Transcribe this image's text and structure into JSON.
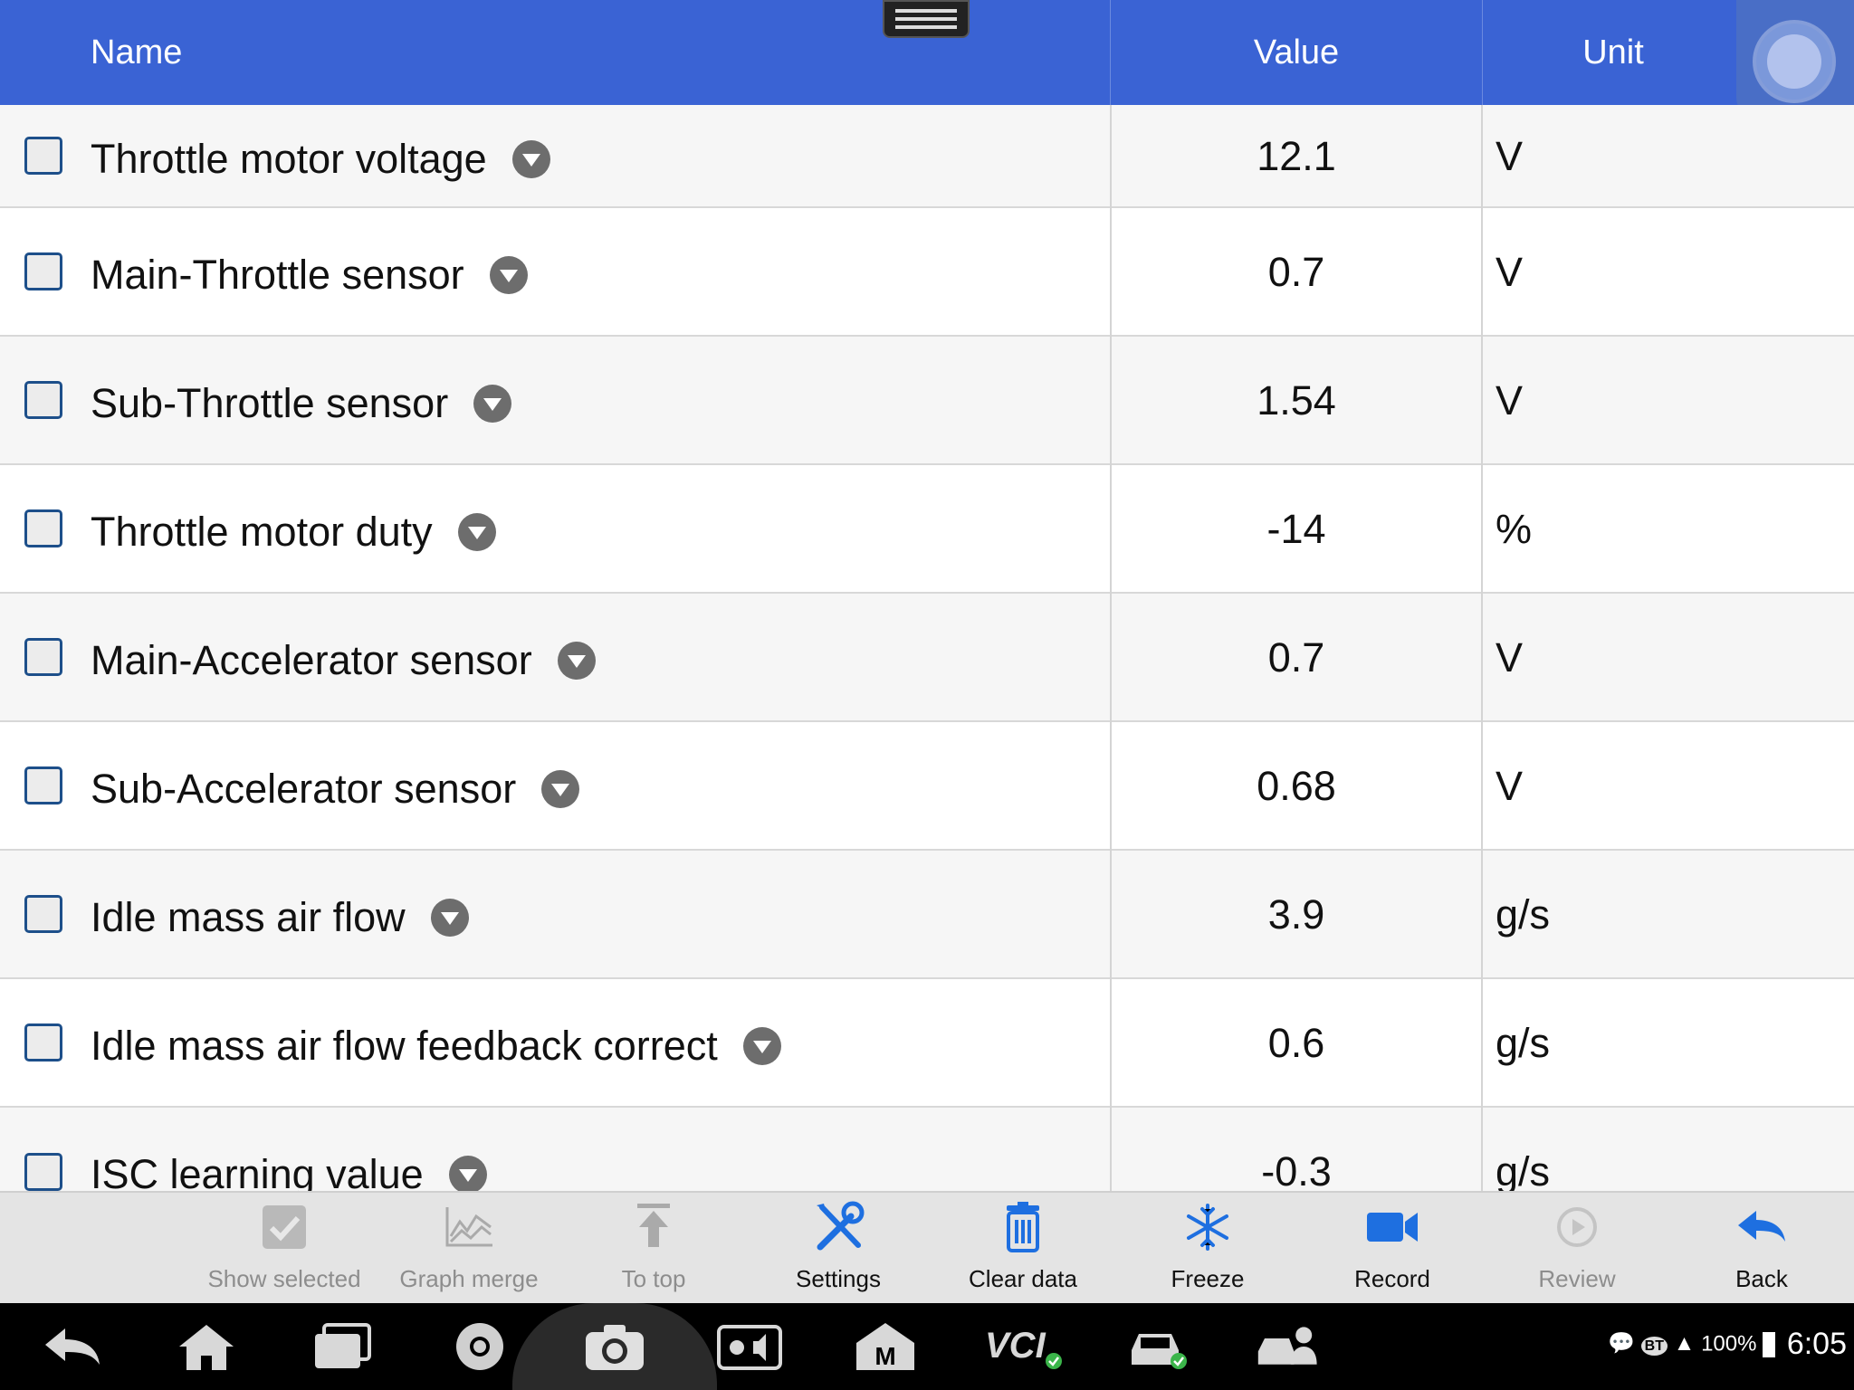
{
  "header": {
    "name": "Name",
    "value": "Value",
    "unit": "Unit"
  },
  "rows": [
    {
      "name": "Throttle motor voltage",
      "value": "12.1",
      "unit": "V"
    },
    {
      "name": "Main-Throttle sensor",
      "value": "0.7",
      "unit": "V"
    },
    {
      "name": "Sub-Throttle sensor",
      "value": "1.54",
      "unit": "V"
    },
    {
      "name": "Throttle motor duty",
      "value": "-14",
      "unit": "%"
    },
    {
      "name": "Main-Accelerator sensor",
      "value": "0.7",
      "unit": "V"
    },
    {
      "name": "Sub-Accelerator sensor",
      "value": "0.68",
      "unit": "V"
    },
    {
      "name": "Idle mass air flow",
      "value": "3.9",
      "unit": "g/s"
    },
    {
      "name": "Idle mass air flow feedback correct",
      "value": "0.6",
      "unit": "g/s"
    },
    {
      "name": "ISC learning value",
      "value": "-0.3",
      "unit": "g/s"
    }
  ],
  "toolbar": {
    "show_selected": "Show selected",
    "graph_merge": "Graph merge",
    "to_top": "To top",
    "settings": "Settings",
    "clear_data": "Clear data",
    "freeze": "Freeze",
    "record": "Record",
    "review": "Review",
    "back": "Back"
  },
  "status_bar": {
    "bt": "BT",
    "battery": "100%",
    "time": "6:05"
  },
  "nav_icons": [
    "back-arrow-icon",
    "home-icon",
    "recent-apps-icon",
    "chrome-icon",
    "camera-icon",
    "brightness-volume-icon",
    "maxifix-icon",
    "vci-icon",
    "vehicle-connected-icon",
    "remote-expert-icon"
  ],
  "colors": {
    "header_bg": "#3a63d4",
    "accent_blue": "#1e6fe0",
    "toolbar_bg": "#e4e4e4",
    "nav_bg": "#000000"
  }
}
